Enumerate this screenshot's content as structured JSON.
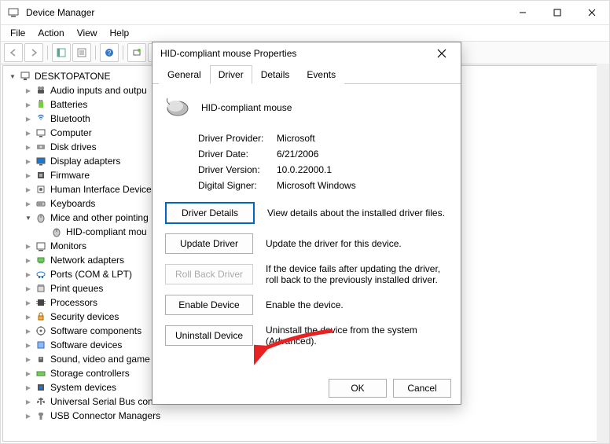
{
  "window": {
    "title": "Device Manager",
    "menus": {
      "file": "File",
      "action": "Action",
      "view": "View",
      "help": "Help"
    }
  },
  "tree": {
    "root": "DESKTOPATONE",
    "items": [
      "Audio inputs and outpu",
      "Batteries",
      "Bluetooth",
      "Computer",
      "Disk drives",
      "Display adapters",
      "Firmware",
      "Human Interface Device",
      "Keyboards",
      "Mice and other pointing",
      "Monitors",
      "Network adapters",
      "Ports (COM & LPT)",
      "Print queues",
      "Processors",
      "Security devices",
      "Software components",
      "Software devices",
      "Sound, video and game",
      "Storage controllers",
      "System devices",
      "Universal Serial Bus cont",
      "USB Connector Managers"
    ],
    "mouse_child": "HID-compliant mou"
  },
  "dialog": {
    "title": "HID-compliant mouse Properties",
    "tabs": {
      "general": "General",
      "driver": "Driver",
      "details": "Details",
      "events": "Events"
    },
    "device": "HID-compliant mouse",
    "info": {
      "provider_label": "Driver Provider:",
      "provider_value": "Microsoft",
      "date_label": "Driver Date:",
      "date_value": "6/21/2006",
      "version_label": "Driver Version:",
      "version_value": "10.0.22000.1",
      "signer_label": "Digital Signer:",
      "signer_value": "Microsoft Windows"
    },
    "buttons": {
      "details": "Driver Details",
      "details_desc": "View details about the installed driver files.",
      "update": "Update Driver",
      "update_desc": "Update the driver for this device.",
      "rollback": "Roll Back Driver",
      "rollback_desc": "If the device fails after updating the driver, roll back to the previously installed driver.",
      "enable": "Enable Device",
      "enable_desc": "Enable the device.",
      "uninstall": "Uninstall Device",
      "uninstall_desc": "Uninstall the device from the system (Advanced)."
    },
    "ok": "OK",
    "cancel": "Cancel"
  }
}
